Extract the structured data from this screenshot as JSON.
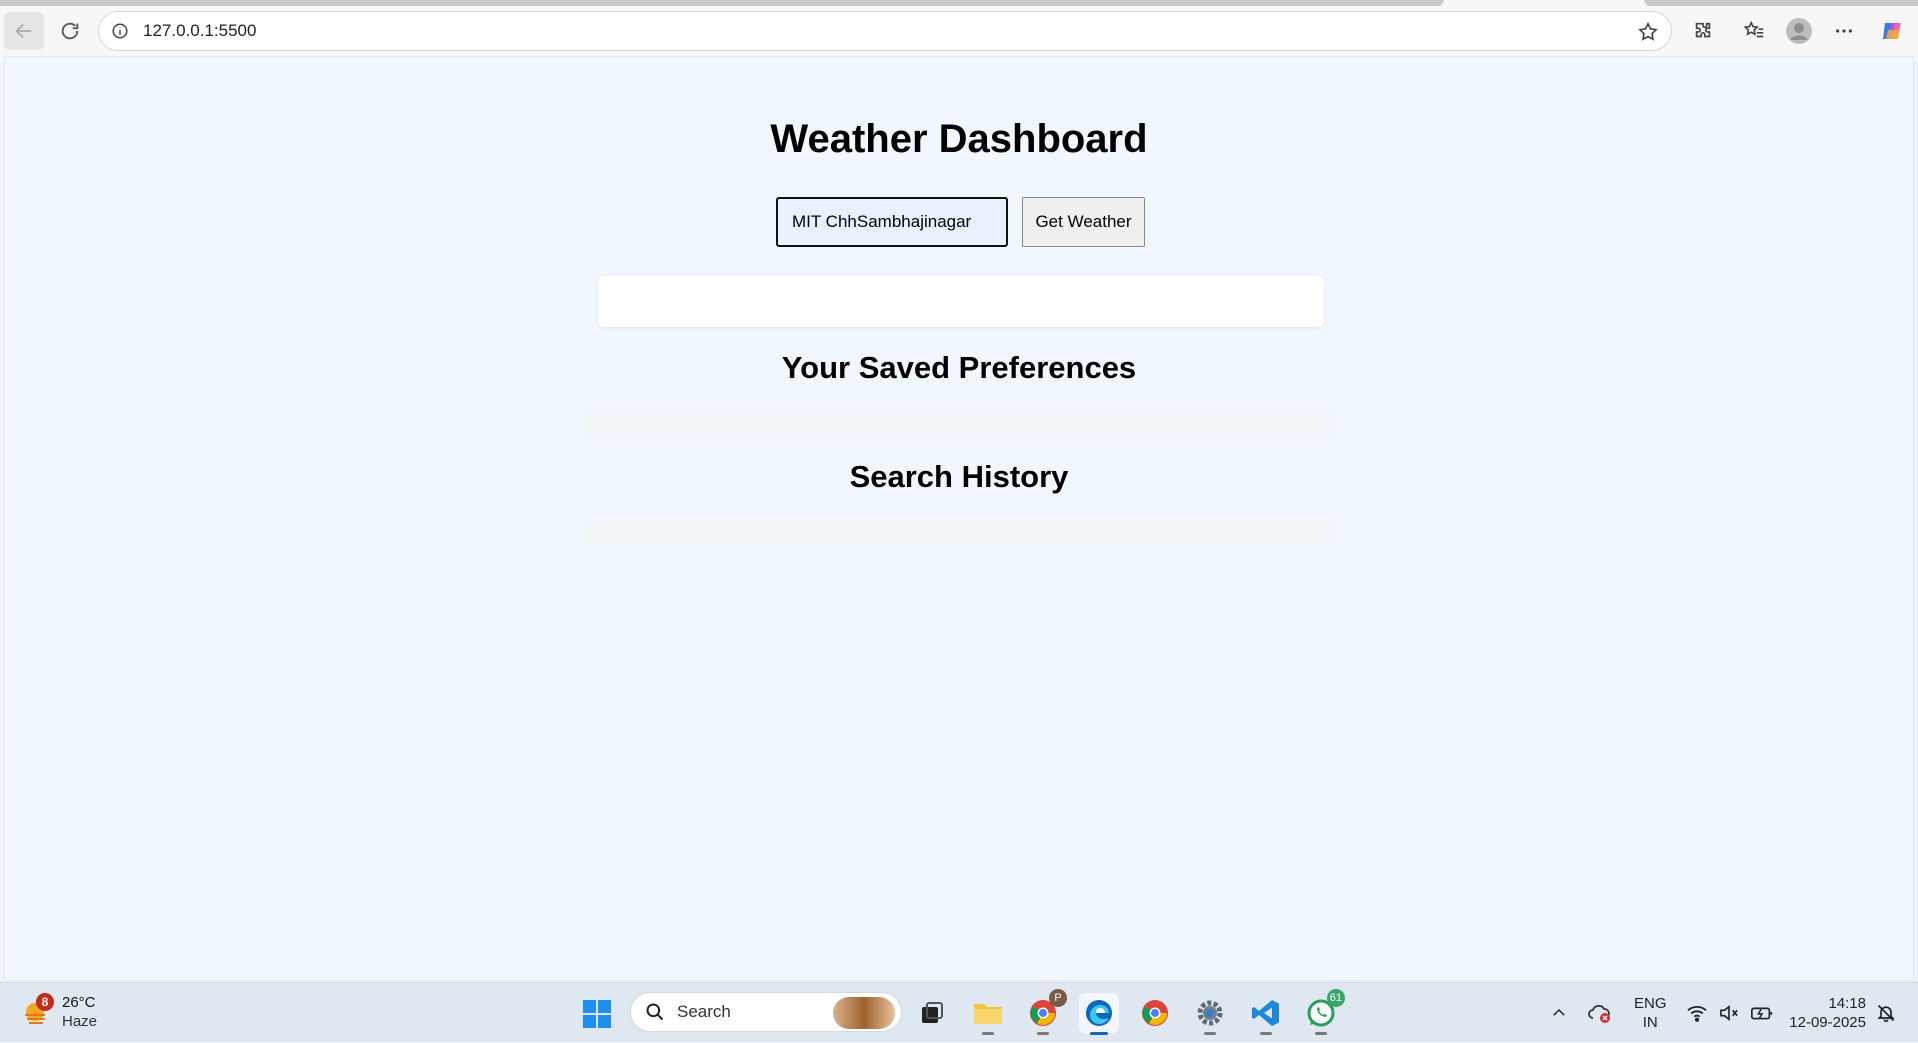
{
  "browser": {
    "url": "127.0.0.1:5500"
  },
  "page": {
    "title": "Weather Dashboard",
    "city_input_value": "MIT ChhSambhajinagar",
    "get_weather_label": "Get Weather",
    "saved_preferences_heading": "Your Saved Preferences",
    "search_history_heading": "Search History"
  },
  "taskbar": {
    "weather": {
      "temp": "26°C",
      "condition": "Haze",
      "badge": "8"
    },
    "search_label": "Search",
    "apps": [
      {
        "name": "task-view",
        "icon": "task-view-icon"
      },
      {
        "name": "file-explorer",
        "icon": "folder-icon"
      },
      {
        "name": "chrome-profile",
        "icon": "chrome-icon",
        "badge": "P"
      },
      {
        "name": "edge",
        "icon": "edge-icon"
      },
      {
        "name": "chrome",
        "icon": "chrome-icon"
      },
      {
        "name": "settings",
        "icon": "gear-icon"
      },
      {
        "name": "vscode",
        "icon": "vscode-icon"
      },
      {
        "name": "whatsapp",
        "icon": "whatsapp-icon",
        "badge": "61"
      }
    ],
    "language_line1": "ENG",
    "language_line2": "IN",
    "time": "14:18",
    "date": "12-09-2025"
  },
  "colors": {
    "page_background": "#f0f7ff",
    "input_background": "#e9f0fe",
    "taskbar": "#dfe7f1",
    "edge_blue": "#0b67c2"
  }
}
